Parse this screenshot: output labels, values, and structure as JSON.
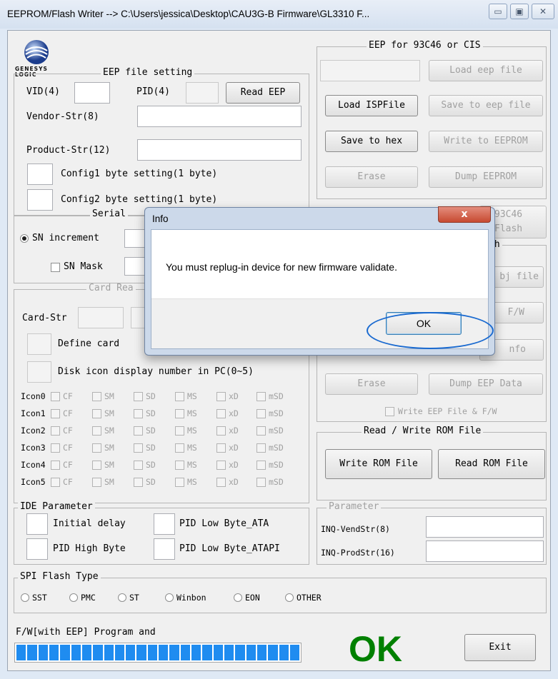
{
  "title": "EEPROM/Flash Writer --> C:\\Users\\jessica\\Desktop\\CAU3G-B Firmware\\GL3310 F...",
  "caption_buttons": {
    "minimize": "▭",
    "maximize": "▣",
    "close": "✕"
  },
  "logo_text": "GENESYS LOGIC",
  "eep_file_setting": {
    "title": "EEP file setting",
    "vid": "VID(4)",
    "pid": "PID(4)",
    "read_eep": "Read EEP",
    "vendor_str": "Vendor-Str(8)",
    "product_str": "Product-Str(12)",
    "config1": "Config1 byte setting(1 byte)",
    "config2": "Config2 byte setting(1 byte)"
  },
  "serial": {
    "title": "Serial",
    "sn_increment": "SN increment",
    "sn_mask": "SN Mask"
  },
  "card_reader": {
    "title": "Card Rea",
    "card_str": "Card-Str",
    "define_card": "Define card",
    "disk_icon": "Disk icon display number in PC(0~5)"
  },
  "icons": {
    "rows": [
      "Icon0",
      "Icon1",
      "Icon2",
      "Icon3",
      "Icon4",
      "Icon5"
    ],
    "cols": [
      "CF",
      "SM",
      "SD",
      "MS",
      "xD",
      "mSD"
    ]
  },
  "ide": {
    "title": "IDE Parameter",
    "initial_delay": "Initial delay",
    "pid_low_ata": "PID Low Byte_ATA",
    "pid_high": "PID High Byte",
    "pid_low_atapi": "PID Low Byte_ATAPI"
  },
  "spi": {
    "title": "SPI Flash Type",
    "options": [
      "SST",
      "PMC",
      "ST",
      "Winbon",
      "EON",
      "OTHER"
    ]
  },
  "progress": {
    "label": "F/W[with EEP] Program and",
    "segments": 26
  },
  "ok_text": "OK",
  "exit": "Exit",
  "eep93": {
    "title": "EEP for 93C46 or CIS",
    "load_eep": "Load eep file",
    "load_isp": "Load ISPFile",
    "save_eep": "Save to eep file",
    "save_hex": "Save to hex",
    "write_eeprom": "Write to EEPROM",
    "erase": "Erase",
    "dump_eeprom": "Dump EEPROM"
  },
  "partial": {
    "a": "93C46",
    "b": "Flash",
    "c": "sh",
    "d": "bj file",
    "e": "F/W",
    "f": "nfo"
  },
  "flash": {
    "erase": "Erase",
    "dump_eep": "Dump EEP Data",
    "write_eep": "Write EEP File & F/W"
  },
  "rom": {
    "title": "Read / Write ROM File",
    "write": "Write ROM File",
    "read": "Read ROM File"
  },
  "param": {
    "title": "Parameter",
    "vend": "INQ-VendStr(8)",
    "prod": "INQ-ProdStr(16)"
  },
  "dialog": {
    "title": "Info",
    "message": "You must replug-in device for new firmware validate.",
    "ok": "OK",
    "close": "x"
  },
  "colors": {
    "ok_green": "#008000",
    "progress_blue": "#1f8cf0",
    "annotation": "#1a6ad0"
  }
}
